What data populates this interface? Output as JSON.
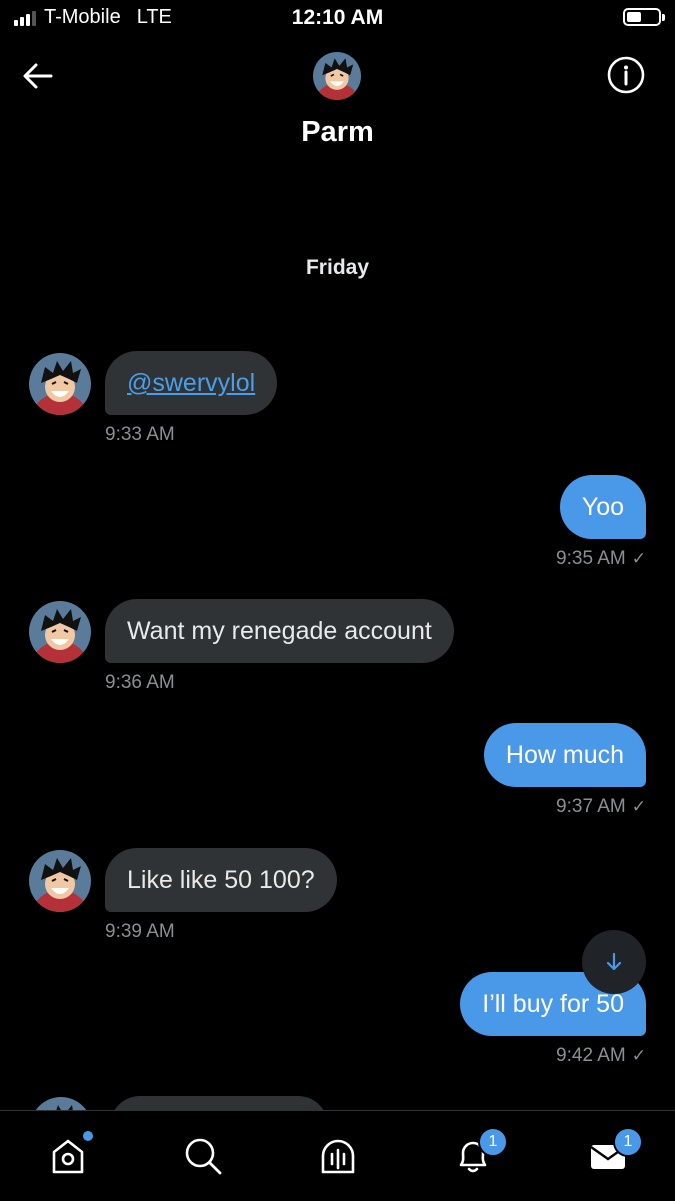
{
  "status_bar": {
    "carrier": "T-Mobile",
    "network": "LTE",
    "time": "12:10 AM"
  },
  "header": {
    "title": "Parm",
    "back_icon": "arrow-left-icon",
    "info_icon": "info-icon"
  },
  "day_label": "Friday",
  "messages": [
    {
      "direction": "in",
      "text": "@swervylol",
      "time": "9:33 AM",
      "is_link": true
    },
    {
      "direction": "out",
      "text": "Yoo",
      "time": "9:35 AM"
    },
    {
      "direction": "in",
      "text": "Want my renegade account",
      "time": "9:36 AM"
    },
    {
      "direction": "out",
      "text": "How much",
      "time": "9:37 AM"
    },
    {
      "direction": "in",
      "text": "Like like 50 100?",
      "time": "9:39 AM"
    },
    {
      "direction": "out",
      "text": "I’ll buy for 50",
      "time": "9:42 AM"
    }
  ],
  "read_mark": "✓",
  "nav": {
    "items": [
      "home-icon",
      "search-icon",
      "spaces-icon",
      "notifications-icon",
      "messages-icon"
    ],
    "notifications_badge": "1",
    "messages_badge": "1"
  },
  "colors": {
    "background": "#000000",
    "outgoing": "#4a98e8",
    "incoming": "#2f3336",
    "link": "#4a9fe8"
  }
}
